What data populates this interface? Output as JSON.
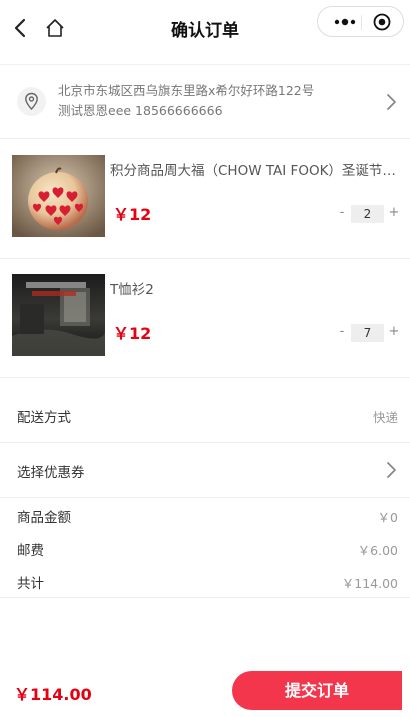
{
  "header": {
    "title": "确认订单"
  },
  "address": {
    "line1": "北京市东城区西乌旗东里路x希尔好环路122号",
    "line2": "测试恩恩eee 18566666666"
  },
  "products": [
    {
      "name": "积分商品周大福（CHOW TAI FOOK）圣诞节礼物",
      "price": "￥12",
      "qty": "2",
      "image": "apple-with-hearts"
    },
    {
      "name": "T恤衫2",
      "price": "￥12",
      "qty": "7",
      "image": "dark-room-poster"
    }
  ],
  "stepper": {
    "minus": "-",
    "plus": "+"
  },
  "delivery": {
    "label": "配送方式",
    "value": "快递"
  },
  "coupon": {
    "label": "选择优惠券"
  },
  "summary": {
    "goods_label": "商品金额",
    "goods_value": "￥0",
    "shipping_label": "邮费",
    "shipping_value": "￥6.00",
    "total_label": "共计",
    "total_value": "￥114.00"
  },
  "footer": {
    "total": "￥114.00",
    "submit_label": "提交订单"
  },
  "colors": {
    "price_red": "#e60012",
    "submit_bg": "#f4364c"
  }
}
